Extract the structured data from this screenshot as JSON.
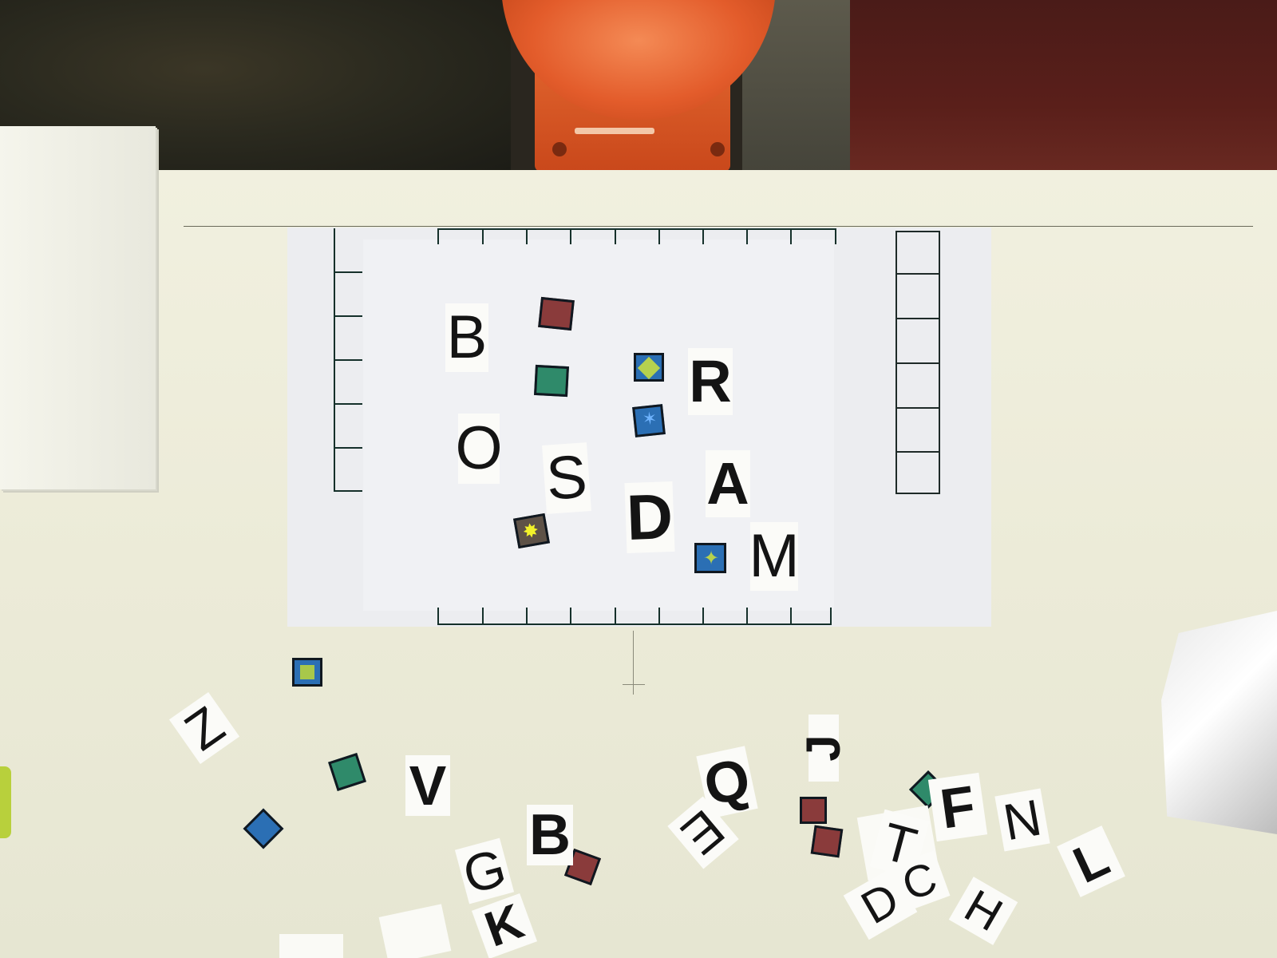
{
  "scene": {
    "description_type": "photo",
    "colors": {
      "robot": "#e35c2b",
      "table": "#ecebd8",
      "grid": "#15302a",
      "tile_green": "#2f8a6a",
      "tile_blue": "#2b6fb4",
      "tile_red": "#8a3b3b",
      "tile_lime": "#a8c84a"
    }
  },
  "board_letters": [
    "B",
    "O",
    "S",
    "D",
    "R",
    "A",
    "M"
  ],
  "loose_letters": [
    "Z",
    "V",
    "B",
    "Q",
    "E",
    "J",
    "G",
    "K",
    "F",
    "T",
    "D",
    "C",
    "H",
    "L",
    "N"
  ]
}
